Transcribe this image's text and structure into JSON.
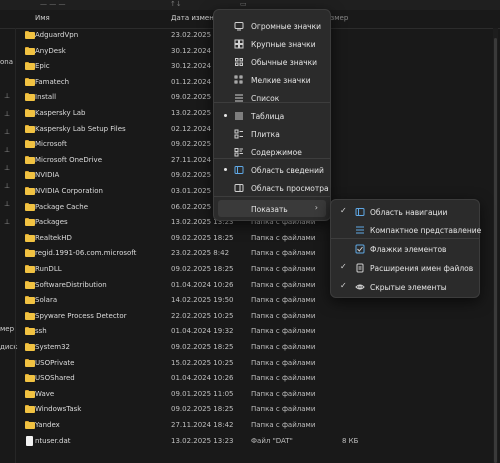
{
  "columns": {
    "name": "Имя",
    "date": "Дата изменения",
    "size": "Размер"
  },
  "left_pane": {
    "top_label": "оna",
    "bottom_labels": [
      "мер",
      "диск"
    ]
  },
  "files": [
    {
      "name": "AdguardVpn",
      "date": "23.02.2025 8:4",
      "type": "",
      "size": "",
      "kind": "folder"
    },
    {
      "name": "AnyDesk",
      "date": "30.12.2024 16:",
      "type": "",
      "size": "",
      "kind": "folder"
    },
    {
      "name": "Epic",
      "date": "30.12.2024 20:",
      "type": "",
      "size": "",
      "kind": "folder"
    },
    {
      "name": "Famatech",
      "date": "01.12.2024 16:",
      "type": "",
      "size": "",
      "kind": "folder"
    },
    {
      "name": "Install",
      "date": "09.02.2025 18:",
      "type": "",
      "size": "",
      "kind": "folder"
    },
    {
      "name": "Kaspersky Lab",
      "date": "13.02.2025 13:",
      "type": "",
      "size": "",
      "kind": "folder"
    },
    {
      "name": "Kaspersky Lab Setup Files",
      "date": "02.12.2024 11:",
      "type": "",
      "size": "",
      "kind": "folder"
    },
    {
      "name": "Microsoft",
      "date": "09.02.2025 18:",
      "type": "",
      "size": "",
      "kind": "folder"
    },
    {
      "name": "Microsoft OneDrive",
      "date": "27.11.2024 18:",
      "type": "",
      "size": "",
      "kind": "folder"
    },
    {
      "name": "NVIDIA",
      "date": "09.02.2025 18:",
      "type": "",
      "size": "",
      "kind": "folder"
    },
    {
      "name": "NVIDIA Corporation",
      "date": "03.01.2025 12:",
      "type": "",
      "size": "",
      "kind": "folder"
    },
    {
      "name": "Package Cache",
      "date": "06.02.2025 21:",
      "type": "",
      "size": "",
      "kind": "folder"
    },
    {
      "name": "Packages",
      "date": "13.02.2025 13:23",
      "type": "Папка с файлами",
      "size": "",
      "kind": "folder"
    },
    {
      "name": "RealtekHD",
      "date": "09.02.2025 18:25",
      "type": "Папка с файлами",
      "size": "",
      "kind": "folder"
    },
    {
      "name": "regid.1991-06.com.microsoft",
      "date": "23.02.2025 8:42",
      "type": "Папка с файлами",
      "size": "",
      "kind": "folder"
    },
    {
      "name": "RunDLL",
      "date": "09.02.2025 18:25",
      "type": "Папка с файлами",
      "size": "",
      "kind": "folder"
    },
    {
      "name": "SoftwareDistribution",
      "date": "01.04.2024 10:26",
      "type": "Папка с файлами",
      "size": "",
      "kind": "folder"
    },
    {
      "name": "Solara",
      "date": "14.02.2025 19:50",
      "type": "Папка с файлами",
      "size": "",
      "kind": "folder"
    },
    {
      "name": "Spyware Process Detector",
      "date": "22.02.2025 10:25",
      "type": "Папка с файлами",
      "size": "",
      "kind": "folder"
    },
    {
      "name": "ssh",
      "date": "01.04.2024 19:32",
      "type": "Папка с файлами",
      "size": "",
      "kind": "folder"
    },
    {
      "name": "System32",
      "date": "09.02.2025 18:25",
      "type": "Папка с файлами",
      "size": "",
      "kind": "folder"
    },
    {
      "name": "USOPrivate",
      "date": "15.02.2025 10:25",
      "type": "Папка с файлами",
      "size": "",
      "kind": "folder"
    },
    {
      "name": "USOShared",
      "date": "01.04.2024 10:26",
      "type": "Папка с файлами",
      "size": "",
      "kind": "folder"
    },
    {
      "name": "Wave",
      "date": "09.01.2025 11:05",
      "type": "Папка с файлами",
      "size": "",
      "kind": "folder"
    },
    {
      "name": "WindowsTask",
      "date": "09.02.2025 18:25",
      "type": "Папка с файлами",
      "size": "",
      "kind": "folder"
    },
    {
      "name": "Yandex",
      "date": "27.11.2024 18:42",
      "type": "Папка с файлами",
      "size": "",
      "kind": "folder"
    },
    {
      "name": "ntuser.dat",
      "date": "13.02.2025 13:23",
      "type": "Файл \"DAT\"",
      "size": "8 КБ",
      "kind": "file"
    }
  ],
  "view_menu": {
    "items": [
      {
        "label": "Огромные значки",
        "icon": "monitor-icon",
        "state": ""
      },
      {
        "label": "Крупные значки",
        "icon": "grid-large-icon",
        "state": ""
      },
      {
        "label": "Обычные значки",
        "icon": "grid-medium-icon",
        "state": ""
      },
      {
        "label": "Мелкие значки",
        "icon": "grid-small-icon",
        "state": ""
      },
      {
        "label": "Список",
        "icon": "list-icon",
        "state": ""
      },
      {
        "label": "Таблица",
        "icon": "table-icon",
        "state": "selected"
      },
      {
        "label": "Плитка",
        "icon": "tiles-icon",
        "state": ""
      },
      {
        "label": "Содержимое",
        "icon": "content-icon",
        "state": ""
      },
      {
        "label": "Область сведений",
        "icon": "details-pane-icon",
        "state": "selected"
      },
      {
        "label": "Область просмотра",
        "icon": "preview-pane-icon",
        "state": ""
      },
      {
        "label": "Показать",
        "icon": "",
        "state": "submenu"
      }
    ]
  },
  "show_submenu": {
    "items": [
      {
        "label": "Область навигации",
        "icon": "nav-pane-icon",
        "checked": true
      },
      {
        "label": "Компактное представление",
        "icon": "compact-view-icon",
        "checked": false
      },
      {
        "label": "Флажки элементов",
        "icon": "checkbox-icon",
        "checked": false
      },
      {
        "label": "Расширения имен файлов",
        "icon": "file-ext-icon",
        "checked": true
      },
      {
        "label": "Скрытые элементы",
        "icon": "eye-icon",
        "checked": true
      }
    ]
  },
  "colors": {
    "background": "#191919",
    "menu_bg": "#2b2b2b",
    "folder": "#f1c242",
    "accent_check": "#4aa3df"
  }
}
